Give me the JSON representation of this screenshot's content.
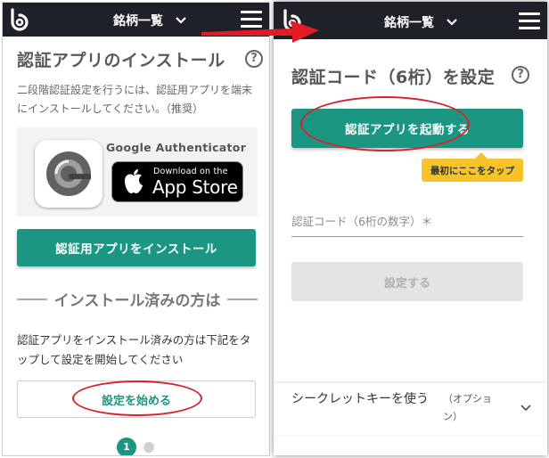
{
  "left": {
    "header": {
      "title": "銘柄一覧"
    },
    "title": "認証アプリのインストール",
    "help": "?",
    "description": "二段階認証設定を行うには、認証用アプリを端末にインストールしてください。（推奨）",
    "app_name": "Google Authenticator",
    "appstore_small": "Download on the",
    "appstore_big": "App Store",
    "install_button": "認証用アプリをインストール",
    "installed_heading": "インストール済みの方は",
    "installed_description": "認証アプリをインストール済みの方は下記をタップして設定を開始してください",
    "start_button": "設定を始める",
    "pager": {
      "current": "1"
    }
  },
  "right": {
    "header": {
      "title": "銘柄一覧"
    },
    "title": "認証コード（6桁）を設定",
    "help": "?",
    "launch_button": "認証アプリを起動する",
    "tooltip": "最初にここをタップ",
    "code_label": "認証コード（6桁の数字）＊",
    "submit_button": "設定する",
    "secret_key_label": "シークレットキーを使う",
    "secret_key_option": "（オプション）"
  },
  "colors": {
    "header_bg": "#1f2129",
    "primary": "#1b9683",
    "annotation_red": "#d8222b",
    "tooltip_yellow": "#f6c42a"
  },
  "icons": [
    "logo-b-icon",
    "chevron-down-icon",
    "hamburger-menu-icon",
    "help-circle-icon",
    "authenticator-icon",
    "apple-icon",
    "red-arrow"
  ]
}
